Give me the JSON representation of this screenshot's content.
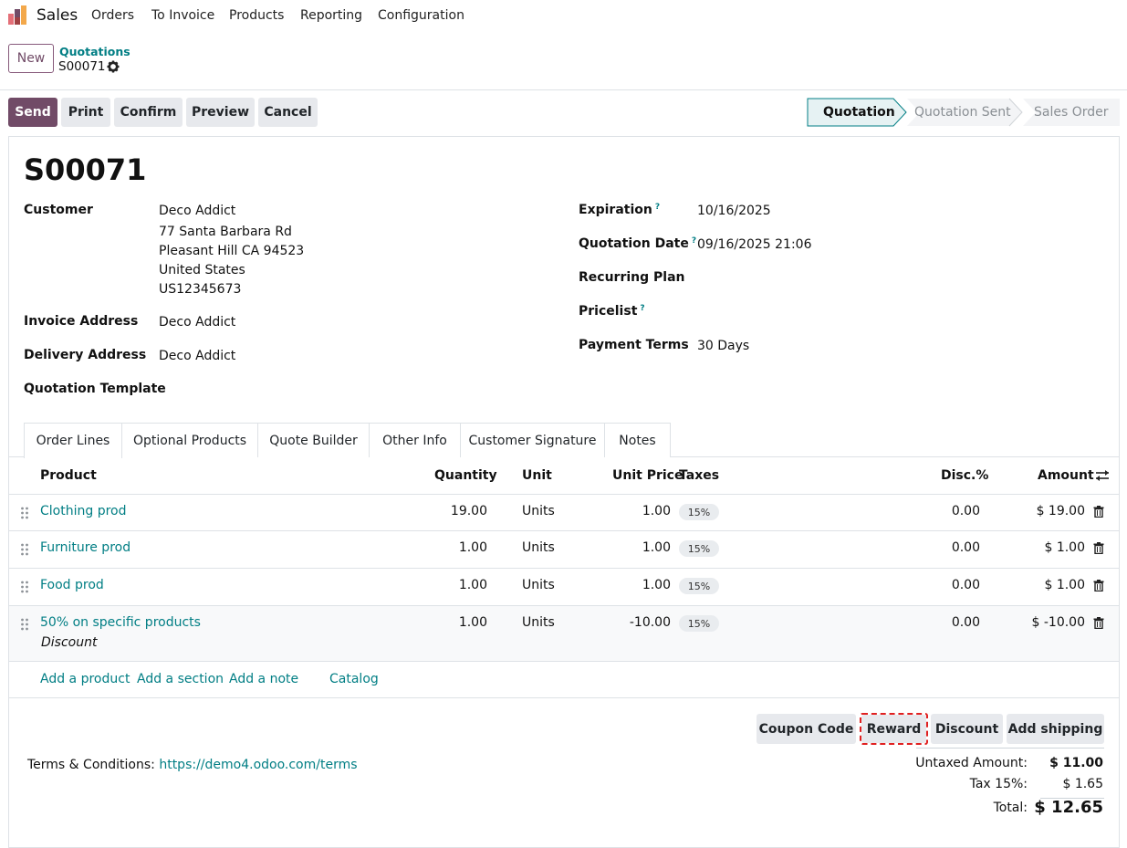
{
  "app": {
    "title": "Sales",
    "menu": [
      "Orders",
      "To Invoice",
      "Products",
      "Reporting",
      "Configuration"
    ]
  },
  "control_panel": {
    "new_label": "New",
    "breadcrumb_parent": "Quotations",
    "breadcrumb_current": "S00071"
  },
  "actions": {
    "send": "Send",
    "print": "Print",
    "confirm": "Confirm",
    "preview": "Preview",
    "cancel": "Cancel"
  },
  "statusbar": {
    "stages": [
      "Quotation",
      "Quotation Sent",
      "Sales Order"
    ],
    "active": "Quotation"
  },
  "form": {
    "title": "S00071",
    "customer_label": "Customer",
    "customer_name": "Deco Addict",
    "customer_address": [
      "77 Santa Barbara Rd",
      "Pleasant Hill CA 94523",
      "United States",
      "US12345673"
    ],
    "invoice_address_label": "Invoice Address",
    "invoice_address": "Deco Addict",
    "delivery_address_label": "Delivery Address",
    "delivery_address": "Deco Addict",
    "quotation_template_label": "Quotation Template",
    "expiration_label": "Expiration",
    "expiration": "10/16/2025",
    "quotation_date_label": "Quotation Date",
    "quotation_date": "09/16/2025 21:06",
    "recurring_plan_label": "Recurring Plan",
    "pricelist_label": "Pricelist",
    "payment_terms_label": "Payment Terms",
    "payment_terms": "30 Days",
    "help_mark": "?"
  },
  "tabs": [
    "Order Lines",
    "Optional Products",
    "Quote Builder",
    "Other Info",
    "Customer Signature",
    "Notes"
  ],
  "table": {
    "headers": {
      "product": "Product",
      "quantity": "Quantity",
      "unit": "Unit",
      "unit_price": "Unit Price",
      "taxes": "Taxes",
      "disc": "Disc.%",
      "amount": "Amount"
    },
    "rows": [
      {
        "product": "Clothing prod",
        "quantity": "19.00",
        "unit": "Units",
        "unit_price": "1.00",
        "tax": "15%",
        "disc": "0.00",
        "amount": "$ 19.00"
      },
      {
        "product": "Furniture prod",
        "quantity": "1.00",
        "unit": "Units",
        "unit_price": "1.00",
        "tax": "15%",
        "disc": "0.00",
        "amount": "$ 1.00"
      },
      {
        "product": "Food prod",
        "quantity": "1.00",
        "unit": "Units",
        "unit_price": "1.00",
        "tax": "15%",
        "disc": "0.00",
        "amount": "$ 1.00"
      },
      {
        "product": "50% on specific products",
        "subtitle": "Discount",
        "quantity": "1.00",
        "unit": "Units",
        "unit_price": "-10.00",
        "tax": "15%",
        "disc": "0.00",
        "amount": "$ -10.00"
      }
    ],
    "add_product": "Add a product",
    "add_section": "Add a section",
    "add_note": "Add a note",
    "catalog": "Catalog"
  },
  "bottom_buttons": {
    "coupon_code": "Coupon Code",
    "reward": "Reward",
    "discount": "Discount",
    "add_shipping": "Add shipping"
  },
  "terms": {
    "label": "Terms & Conditions:",
    "link": "https://demo4.odoo.com/terms"
  },
  "totals": {
    "untaxed_label": "Untaxed Amount:",
    "untaxed": "$ 11.00",
    "tax_label": "Tax 15%:",
    "tax": "$ 1.65",
    "total_label": "Total:",
    "total": "$ 12.65"
  },
  "colors": {
    "primary": "#714b67",
    "link": "#017e84",
    "highlight_outline": "#e02020"
  }
}
